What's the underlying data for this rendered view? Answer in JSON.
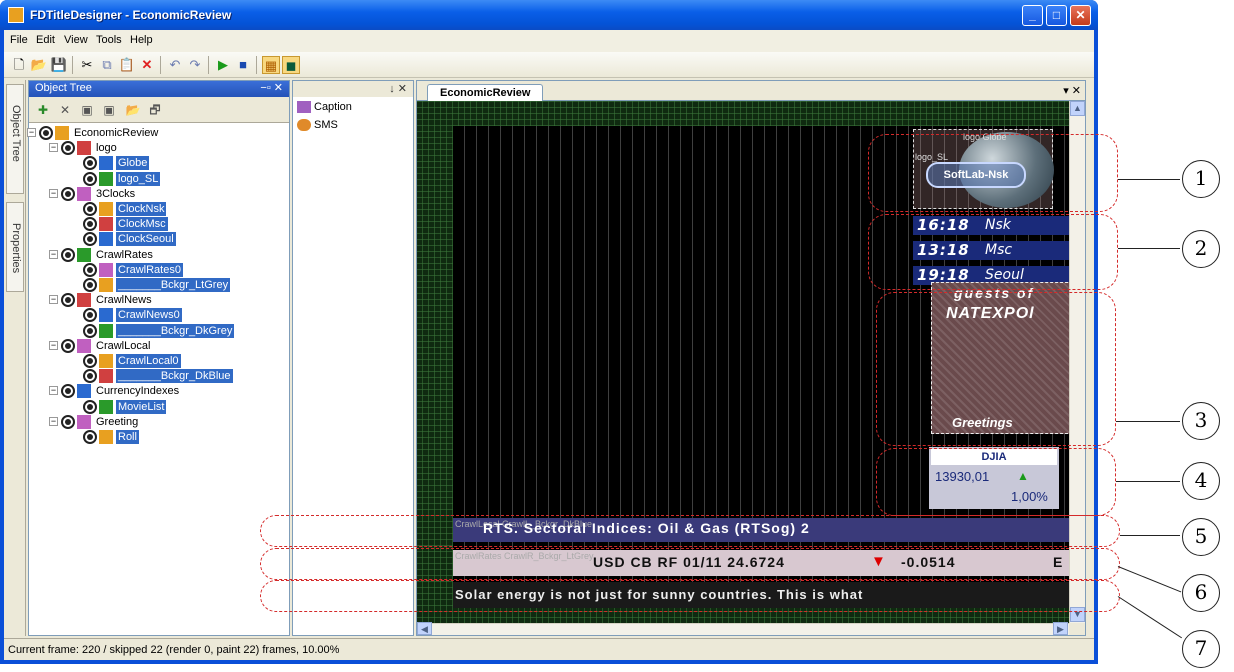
{
  "window": {
    "title": "FDTitleDesigner - EconomicReview"
  },
  "menu": [
    "File",
    "Edit",
    "View",
    "Tools",
    "Help"
  ],
  "side_tabs": [
    "Object Tree",
    "Properties"
  ],
  "object_tree": {
    "title": "Object Tree",
    "pin_close": "−▫ ✕",
    "nodes": [
      {
        "label": "EconomicReview",
        "level": 0,
        "selected": false
      },
      {
        "label": "logo",
        "level": 1,
        "selected": false
      },
      {
        "label": "Globe",
        "level": 2,
        "selected": true
      },
      {
        "label": "logo_SL",
        "level": 2,
        "selected": true
      },
      {
        "label": "3Clocks",
        "level": 1,
        "selected": false
      },
      {
        "label": "ClockNsk",
        "level": 2,
        "selected": true
      },
      {
        "label": "ClockMsc",
        "level": 2,
        "selected": true
      },
      {
        "label": "ClockSeoul",
        "level": 2,
        "selected": true
      },
      {
        "label": "CrawlRates",
        "level": 1,
        "selected": false
      },
      {
        "label": "CrawlRates0",
        "level": 2,
        "selected": true
      },
      {
        "label": "_______Bckgr_LtGrey",
        "level": 2,
        "selected": true
      },
      {
        "label": "CrawlNews",
        "level": 1,
        "selected": false
      },
      {
        "label": "CrawlNews0",
        "level": 2,
        "selected": true
      },
      {
        "label": "_______Bckgr_DkGrey",
        "level": 2,
        "selected": true
      },
      {
        "label": "CrawlLocal",
        "level": 1,
        "selected": false
      },
      {
        "label": "CrawlLocal0",
        "level": 2,
        "selected": true
      },
      {
        "label": "_______Bckgr_DkBlue",
        "level": 2,
        "selected": true
      },
      {
        "label": "CurrencyIndexes",
        "level": 1,
        "selected": false
      },
      {
        "label": "MovieList",
        "level": 2,
        "selected": true
      },
      {
        "label": "Greeting",
        "level": 1,
        "selected": false
      },
      {
        "label": "Roll",
        "level": 2,
        "selected": true
      }
    ]
  },
  "mid_panel": {
    "pin_close": "↓ ✕",
    "items": [
      "Caption",
      "SMS"
    ]
  },
  "document": {
    "tab": "EconomicReview",
    "tab_ctrl": "▾ ✕",
    "logo": {
      "box_label": "logo Globe",
      "small_label": "logo_SL",
      "text": "SoftLab-Nsk"
    },
    "clocks": [
      {
        "time": "16:18",
        "city": "Nsk"
      },
      {
        "time": "13:18",
        "city": "Msc"
      },
      {
        "time": "19:18",
        "city": "Seoul"
      }
    ],
    "roll": {
      "line1": "guests  of",
      "line2": "NATEXPOl",
      "line3": "Greetings"
    },
    "djia": {
      "title": "DJIA",
      "value": "13930,01",
      "pct": "1,00%"
    },
    "crawl_local": {
      "tag": "CrawlLocal CrawlL_Bckgr_DkBlue",
      "text": "RTS. Sectoral Indices:      Oil & Gas (RTSog) 2"
    },
    "crawl_rates": {
      "tag": "CrawlRates CrawlR_Bckgr_LtGrey",
      "text": "USD CB RF 01/11  24.6724",
      "value": "-0.0514",
      "tail": "E"
    },
    "crawl_news": {
      "text": "Solar energy is not just for sunny countries. This is what"
    }
  },
  "status": {
    "text": "Current frame: 220 / skipped 22 (render 0, paint 22) frames, 10.00%"
  },
  "callouts": [
    "1",
    "2",
    "3",
    "4",
    "5",
    "6",
    "7"
  ]
}
